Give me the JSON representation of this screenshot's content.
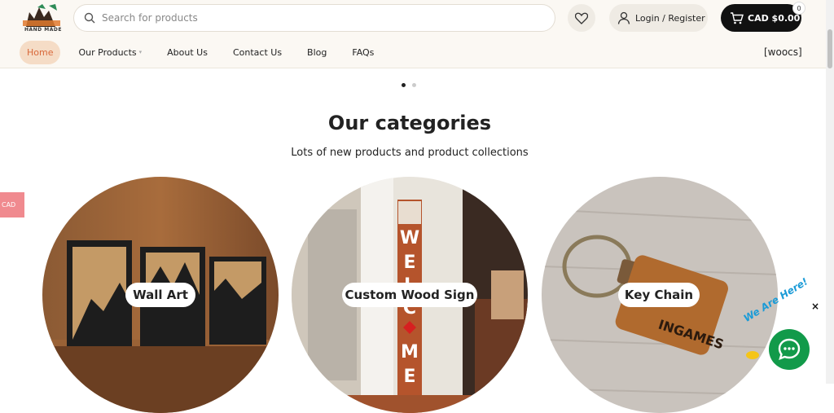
{
  "header": {
    "logo_text": "WOODARTGALLERY.CA",
    "logo_sub": "HAND MADE",
    "search_placeholder": "Search for products",
    "login_label": "Login / Register",
    "cart_label": "CAD $0.00",
    "cart_count": "0"
  },
  "nav": {
    "items": [
      {
        "label": "Home"
      },
      {
        "label": "Our Products"
      },
      {
        "label": "About Us"
      },
      {
        "label": "Contact Us"
      },
      {
        "label": "Blog"
      },
      {
        "label": "FAQs"
      }
    ],
    "currency_switcher": "[woocs]"
  },
  "slider": {
    "active_dot_color": "#222222",
    "inactive_dot_color": "#cccccc"
  },
  "categories": {
    "title": "Our categories",
    "subtitle": "Lots of new products and product collections",
    "items": [
      {
        "label": "Wall Art"
      },
      {
        "label": "Custom Wood Sign"
      },
      {
        "label": "Key Chain"
      }
    ]
  },
  "side_tab": {
    "label": "CAD"
  },
  "chat": {
    "text": "We Are Here!",
    "close": "×",
    "color": "#129a4a"
  },
  "colors": {
    "accent": "#d8683a",
    "accent_bg": "#f5dcc6",
    "cart_bg": "#111111"
  }
}
